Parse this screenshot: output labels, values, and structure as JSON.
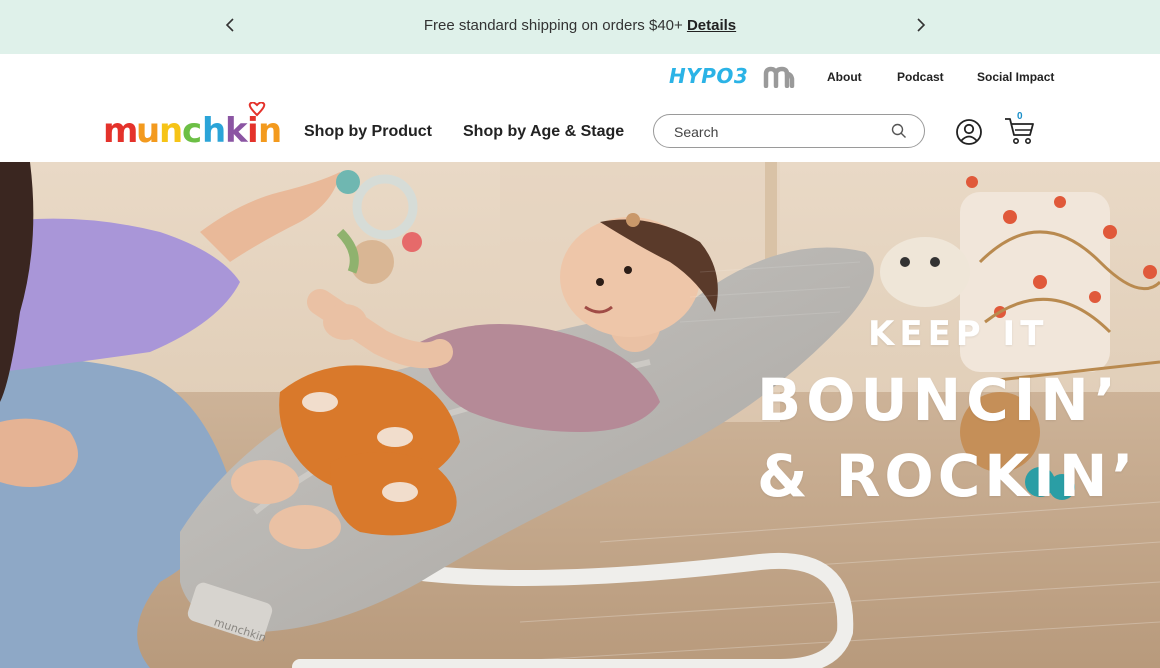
{
  "promo": {
    "message": "Free standard shipping on orders $40+",
    "link_label": "Details"
  },
  "utility_nav": {
    "hypo3_label": "HYPO3",
    "about": "About",
    "podcast": "Podcast",
    "social_impact": "Social Impact"
  },
  "header": {
    "logo_text": "munchkin",
    "nav": [
      "Shop by Product",
      "Shop by Age & Stage"
    ],
    "search_placeholder": "Search",
    "cart_count": "0"
  },
  "hero": {
    "line1": "KEEP IT",
    "line2": "BOUNCIN’",
    "line3": "& ROCKIN’",
    "product_mark": "munchkin"
  },
  "colors": {
    "promo_bg": "#dff1ea",
    "hypo3": "#2bb3e6",
    "cart_badge": "#1a8fc9",
    "logo_letters": [
      "#e4322b",
      "#f39a1e",
      "#f6c417",
      "#6cbf45",
      "#2ba4d8",
      "#8b55a3",
      "#e4322b",
      "#f39a1e"
    ]
  },
  "icons": [
    "chevron-left-icon",
    "chevron-right-icon",
    "m-brand-icon",
    "search-icon",
    "account-icon",
    "cart-icon",
    "heart-icon"
  ]
}
